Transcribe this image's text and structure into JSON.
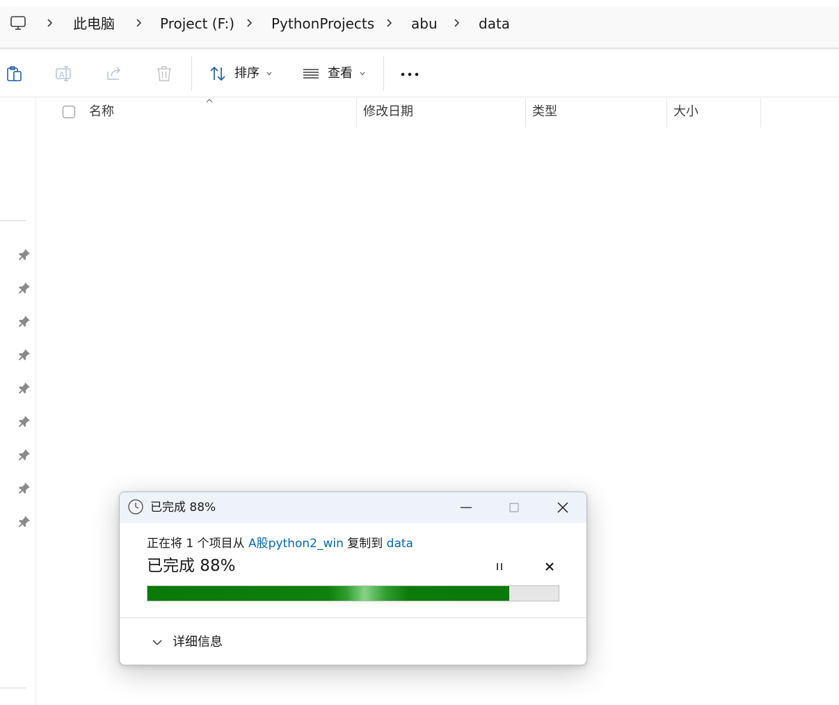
{
  "breadcrumb": {
    "items": [
      "此电脑",
      "Project (F:)",
      "PythonProjects",
      "abu",
      "data"
    ]
  },
  "commandbar": {
    "sort_label": "排序",
    "view_label": "查看"
  },
  "columns": {
    "name": "名称",
    "modified": "修改日期",
    "type": "类型",
    "size": "大小"
  },
  "copy_dialog": {
    "title": "已完成 88%",
    "line_prefix": "正在将 1 个项目从 ",
    "source": "A股python2_win",
    "line_middle": " 复制到 ",
    "destination": "data",
    "status": "已完成 88%",
    "progress_percent": 88,
    "details_label": "详细信息"
  },
  "colors": {
    "accent": "#0067c0",
    "progress_green": "#0a7a0a"
  },
  "icons": {
    "pc": "monitor-icon",
    "paste": "clipboard-icon",
    "rename": "rename-icon",
    "share": "share-icon",
    "delete": "trash-icon",
    "sort": "sort-arrows-icon",
    "view": "list-view-icon",
    "more": "more-dots-icon",
    "pin": "pin-icon",
    "clock": "clock-icon"
  }
}
